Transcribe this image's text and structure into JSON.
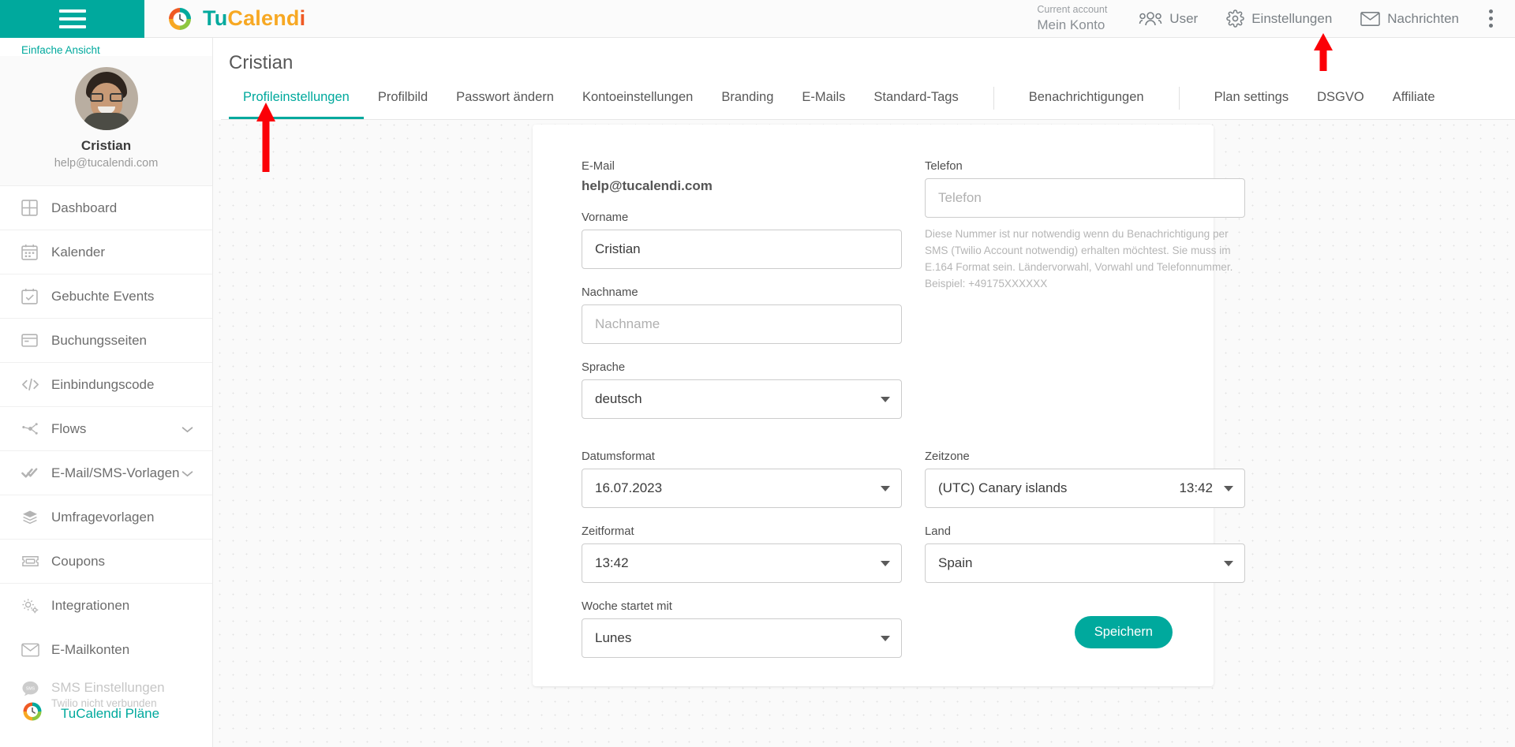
{
  "topbar": {
    "brand": {
      "part1": "Tu",
      "part2": "Calend",
      "part3": "i"
    },
    "account_label": "Current account",
    "account_value": "Mein Konto",
    "nav": [
      {
        "label": "User",
        "icon": "users-icon"
      },
      {
        "label": "Einstellungen",
        "icon": "gear-icon"
      },
      {
        "label": "Nachrichten",
        "icon": "envelope-icon"
      }
    ],
    "menu_icon": "kebab-menu-icon"
  },
  "sidebar": {
    "simple_view": "Einfache Ansicht",
    "profile_name": "Cristian",
    "profile_email": "help@tucalendi.com",
    "items": [
      {
        "label": "Dashboard",
        "icon": "dashboard-grid-icon",
        "chevron": false
      },
      {
        "label": "Kalender",
        "icon": "calendar-icon",
        "chevron": false
      },
      {
        "label": "Gebuchte Events",
        "icon": "calendar-check-icon",
        "chevron": false
      },
      {
        "label": "Buchungsseiten",
        "icon": "window-page-icon",
        "chevron": false
      },
      {
        "label": "Einbindungscode",
        "icon": "code-brackets-icon",
        "chevron": false
      },
      {
        "label": "Flows",
        "icon": "flow-nodes-icon",
        "chevron": true
      },
      {
        "label": "E-Mail/SMS-Vorlagen",
        "icon": "double-check-icon",
        "chevron": true
      },
      {
        "label": "Umfragevorlagen",
        "icon": "layers-icon",
        "chevron": false
      },
      {
        "label": "Coupons",
        "icon": "ticket-icon",
        "chevron": false
      },
      {
        "label": "Integrationen",
        "icon": "gears-icon",
        "chevron": false
      },
      {
        "label": "E-Mailkonten",
        "icon": "envelope-icon",
        "chevron": false
      },
      {
        "label": "SMS Einstellungen",
        "icon": "sms-bubble-icon",
        "chevron": false,
        "sub": "Twilio nicht verbunden",
        "disabled": true
      }
    ],
    "plans_label": "TuCalendi Pläne",
    "plans_icon": "tucalendi-logo-icon"
  },
  "page": {
    "title": "Cristian",
    "tabs": [
      {
        "label": "Profileinstellungen",
        "active": true
      },
      {
        "label": "Profilbild",
        "active": false
      },
      {
        "label": "Passwort ändern",
        "active": false
      },
      {
        "label": "Kontoeinstellungen",
        "active": false
      },
      {
        "label": "Branding",
        "active": false
      },
      {
        "label": "E-Mails",
        "active": false
      },
      {
        "label": "Standard-Tags",
        "active": false
      },
      {
        "label": "Benachrichtigungen",
        "active": false
      },
      {
        "label": "Plan settings",
        "active": false
      },
      {
        "label": "DSGVO",
        "active": false
      },
      {
        "label": "Affiliate",
        "active": false
      }
    ]
  },
  "form": {
    "email_label": "E-Mail",
    "email_value": "help@tucalendi.com",
    "firstname_label": "Vorname",
    "firstname_value": "Cristian",
    "lastname_label": "Nachname",
    "lastname_placeholder": "Nachname",
    "lastname_value": "",
    "language_label": "Sprache",
    "language_value": "deutsch",
    "phone_label": "Telefon",
    "phone_placeholder": "Telefon",
    "phone_value": "",
    "phone_hint": "Diese Nummer ist nur notwendig wenn du Benachrichtigung per SMS (Twilio Account notwendig) erhalten möchtest. Sie muss im E.164 Format sein. Ländervorwahl, Vorwahl und Telefonnummer. Beispiel: +49175XXXXXX",
    "dateformat_label": "Datumsformat",
    "dateformat_value": "16.07.2023",
    "timeformat_label": "Zeitformat",
    "timeformat_value": "13:42",
    "weekstart_label": "Woche startet mit",
    "weekstart_value": "Lunes",
    "timezone_label": "Zeitzone",
    "timezone_value": "(UTC) Canary islands",
    "timezone_time": "13:42",
    "country_label": "Land",
    "country_value": "Spain",
    "save_label": "Speichern"
  },
  "annotations": {
    "arrow_color": "#fb0007",
    "arrows": [
      {
        "name": "arrow-pointing-to-profileinstellungen-tab"
      },
      {
        "name": "arrow-pointing-to-einstellungen-menu"
      }
    ]
  },
  "colors": {
    "accent": "#00a99d",
    "brand_orange": "#f7a823",
    "brand_red": "#ef5a24",
    "brand_green": "#8dc63f"
  }
}
